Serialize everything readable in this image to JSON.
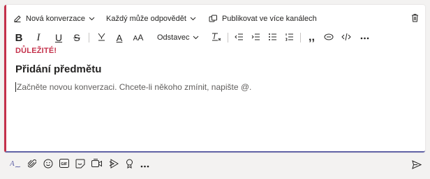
{
  "header": {
    "new_conversation_label": "Nová konverzace",
    "who_can_reply_label": "Každý může odpovědět",
    "publish_label": "Publikovat ve více kanálech"
  },
  "format_toolbar": {
    "paragraph_label": "Odstavec",
    "icons": [
      "bold-icon",
      "italic-icon",
      "underline-icon",
      "strikethrough-icon",
      "highlight-icon",
      "font-color-icon",
      "font-size-icon",
      "paragraph-dropdown",
      "clear-formatting-icon",
      "decrease-indent-icon",
      "increase-indent-icon",
      "bulleted-list-icon",
      "numbered-list-icon",
      "quote-icon",
      "link-icon",
      "code-snippet-icon",
      "more-options-icon"
    ]
  },
  "compose": {
    "importance_label": "DŮLEŽITÉ!",
    "subject": "Přidání předmětu",
    "body_placeholder": "Začněte novou konverzaci. Chcete-li někoho zmínit, napište @."
  },
  "bottom_toolbar": {
    "icons": [
      "format-icon",
      "attach-icon",
      "emoji-icon",
      "gif-icon",
      "sticker-icon",
      "meet-now-icon",
      "stream-icon",
      "praise-icon",
      "more-options-icon",
      "send-icon"
    ]
  },
  "colors": {
    "accent": "#6264a7",
    "important": "#c4314b",
    "text": "#252423",
    "placeholder": "#605e5c",
    "background": "#f3f2f1"
  }
}
